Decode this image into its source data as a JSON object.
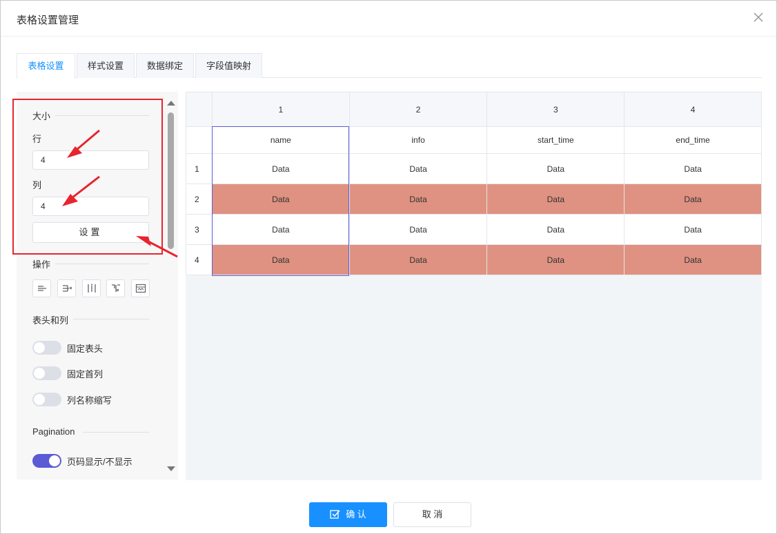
{
  "dialog": {
    "title": "表格设置管理"
  },
  "tabs": [
    {
      "label": "表格设置",
      "active": true
    },
    {
      "label": "样式设置",
      "active": false
    },
    {
      "label": "数据绑定",
      "active": false
    },
    {
      "label": "字段值映射",
      "active": false
    }
  ],
  "left_panel": {
    "size_section": {
      "title": "大小",
      "rows_label": "行",
      "rows_value": "4",
      "cols_label": "列",
      "cols_value": "4",
      "set_button": "设置"
    },
    "ops_section": {
      "title": "操作",
      "icons": [
        "insert-row-icon",
        "delete-column-icon",
        "insert-column-icon",
        "merge-cells-icon",
        "split-cells-icon"
      ]
    },
    "header_section": {
      "title": "表头和列",
      "switches": [
        {
          "label": "固定表头",
          "on": false
        },
        {
          "label": "固定首列",
          "on": false
        },
        {
          "label": "列名称缩写",
          "on": false
        }
      ]
    },
    "pagination_section": {
      "title": "Pagination",
      "switch": {
        "label": "页码显示/不显示",
        "on": true
      }
    }
  },
  "table": {
    "col_headers": [
      "1",
      "2",
      "3",
      "4"
    ],
    "fields": [
      "name",
      "info",
      "start_time",
      "end_time"
    ],
    "rows": [
      {
        "index": "1",
        "cells": [
          "Data",
          "Data",
          "Data",
          "Data"
        ],
        "highlight": false
      },
      {
        "index": "2",
        "cells": [
          "Data",
          "Data",
          "Data",
          "Data"
        ],
        "highlight": true
      },
      {
        "index": "3",
        "cells": [
          "Data",
          "Data",
          "Data",
          "Data"
        ],
        "highlight": false
      },
      {
        "index": "4",
        "cells": [
          "Data",
          "Data",
          "Data",
          "Data"
        ],
        "highlight": true
      }
    ],
    "highlight_color": "#df9281"
  },
  "footer": {
    "confirm_label": "确 认",
    "cancel_label": "取 消"
  },
  "colors": {
    "accent": "#1890ff",
    "switch_on": "#5b5bd6",
    "annotation": "#e8242e"
  }
}
